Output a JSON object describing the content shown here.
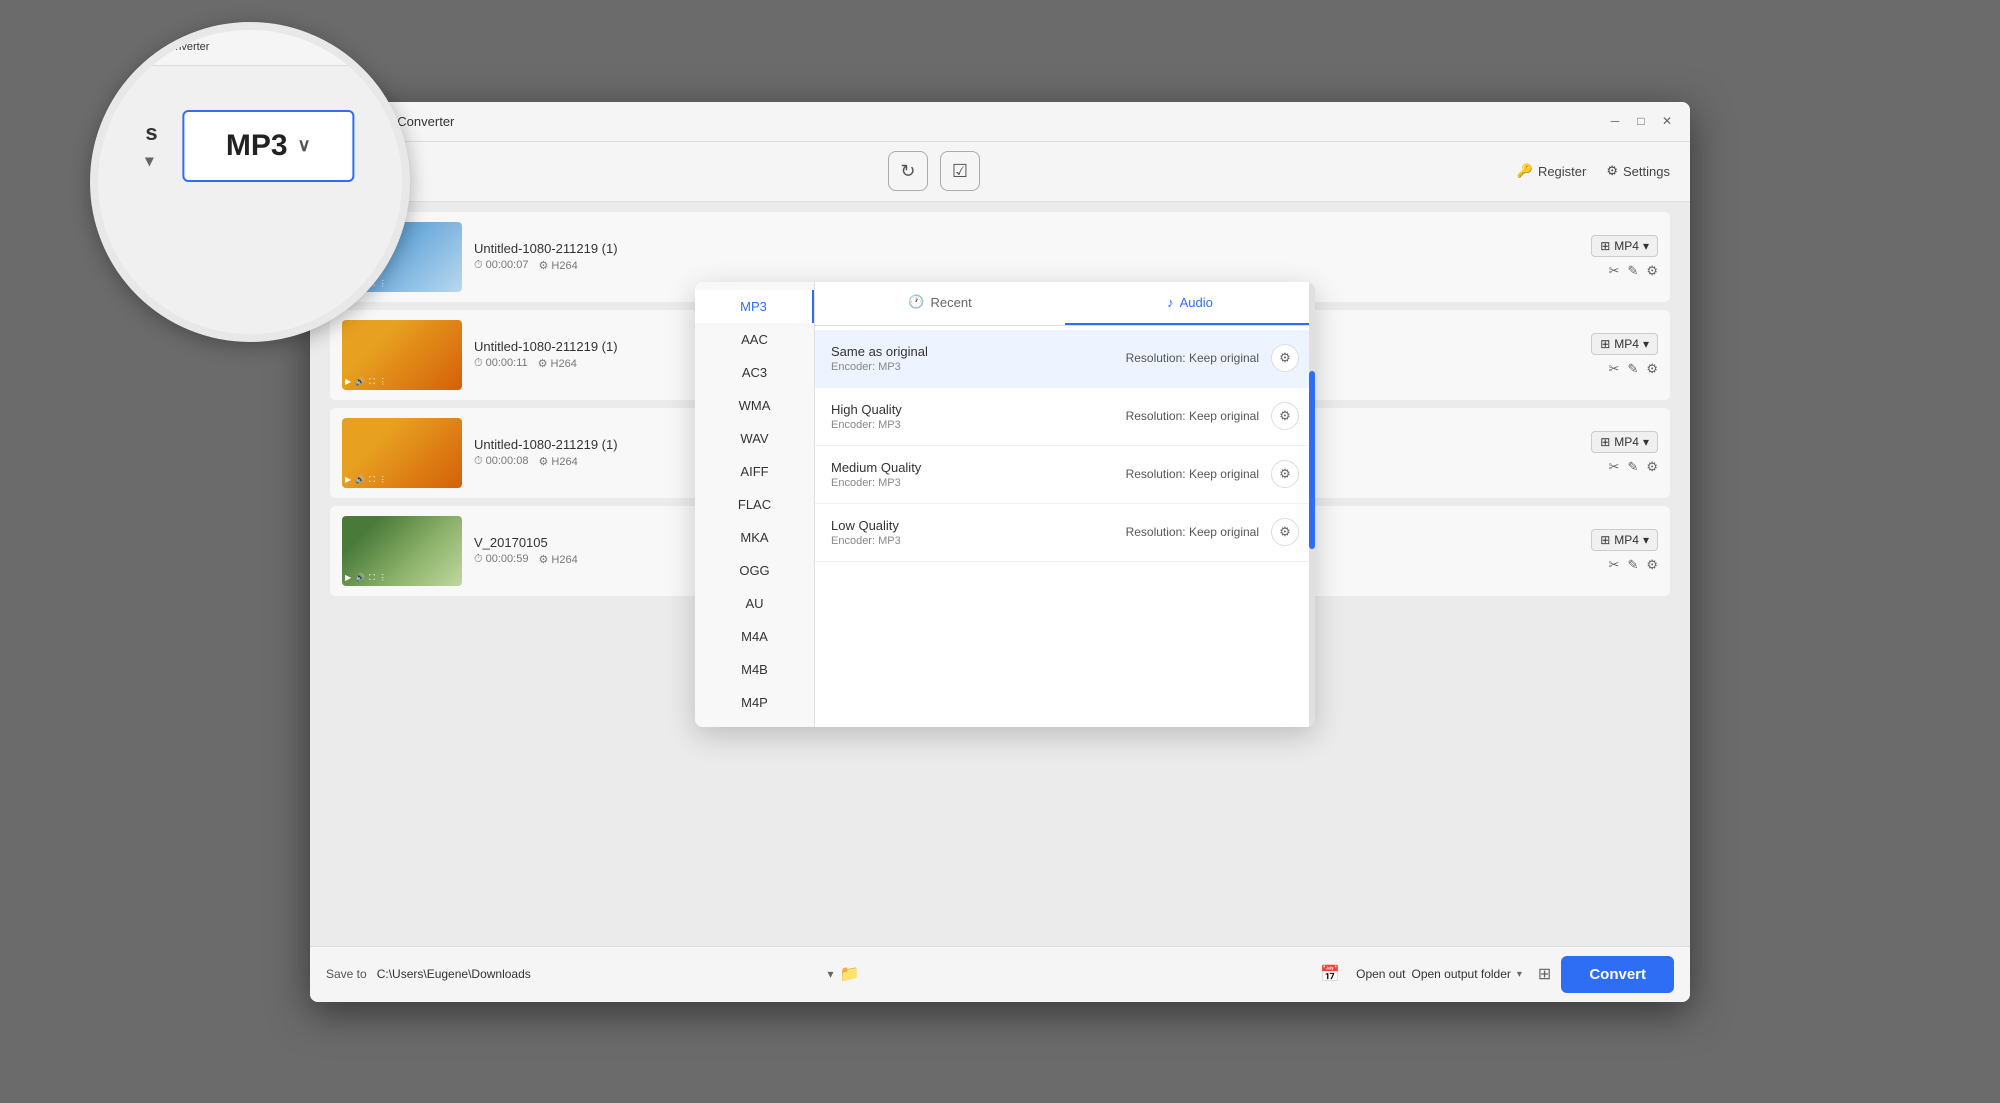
{
  "window": {
    "title": "Aisits Video Converter",
    "title_short": "nverter"
  },
  "titlebar": {
    "minimize_label": "─",
    "maximize_label": "□",
    "close_label": "✕"
  },
  "toolbar": {
    "add_files_label": "s",
    "convert_icon": "↻",
    "check_icon": "✓",
    "register_label": "Register",
    "settings_label": "Settings"
  },
  "videos": [
    {
      "name": "Untitled-1080-211219 (1)",
      "duration": "00:00:07",
      "codec": "H264",
      "format": "MP4",
      "thumb_class": "video-thumb-1"
    },
    {
      "name": "Untitled-1080-211219 (1)",
      "duration": "00:00:11",
      "codec": "H264",
      "format": "MP4",
      "thumb_class": "video-thumb-2"
    },
    {
      "name": "Untitled-1080-211219 (1)",
      "duration": "00:00:08",
      "codec": "H264",
      "format": "MP4",
      "thumb_class": "video-thumb-2"
    },
    {
      "name": "V_20170105",
      "duration": "00:00:59",
      "codec": "H264",
      "format": "MP4",
      "thumb_class": "video-thumb-3"
    }
  ],
  "bottombar": {
    "save_to_label": "Save to",
    "save_path": "C:\\Users\\Eugene\\Downloads",
    "open_output_label": "Open out",
    "open_output_folder_label": "Open output folder",
    "convert_label": "Convert"
  },
  "dropdown": {
    "tabs": [
      {
        "id": "recent",
        "label": "Recent",
        "icon": "🕐",
        "active": false
      },
      {
        "id": "audio",
        "label": "Audio",
        "icon": "♪",
        "active": true
      }
    ],
    "formats": [
      {
        "id": "mp3",
        "label": "MP3",
        "active": true
      },
      {
        "id": "aac",
        "label": "AAC",
        "active": false
      },
      {
        "id": "ac3",
        "label": "AC3",
        "active": false
      },
      {
        "id": "wma",
        "label": "WMA",
        "active": false
      },
      {
        "id": "wav",
        "label": "WAV",
        "active": false
      },
      {
        "id": "aiff",
        "label": "AIFF",
        "active": false
      },
      {
        "id": "flac",
        "label": "FLAC",
        "active": false
      },
      {
        "id": "mka",
        "label": "MKA",
        "active": false
      },
      {
        "id": "ogg",
        "label": "OGG",
        "active": false
      },
      {
        "id": "au",
        "label": "AU",
        "active": false
      },
      {
        "id": "m4a",
        "label": "M4A",
        "active": false
      },
      {
        "id": "m4b",
        "label": "M4B",
        "active": false
      },
      {
        "id": "m4p",
        "label": "M4P",
        "active": false
      }
    ],
    "quality_options": [
      {
        "name": "Same as original",
        "encoder": "Encoder: MP3",
        "resolution": "Resolution: Keep original",
        "selected": true
      },
      {
        "name": "High Quality",
        "encoder": "Encoder: MP3",
        "resolution": "Resolution: Keep original",
        "selected": false
      },
      {
        "name": "Medium Quality",
        "encoder": "Encoder: MP3",
        "resolution": "Resolution: Keep original",
        "selected": false
      },
      {
        "name": "Low Quality",
        "encoder": "Encoder: MP3",
        "resolution": "Resolution: Keep original",
        "selected": false
      }
    ]
  },
  "magnifier": {
    "title": "oits Video Converter",
    "left_label": "s",
    "mp3_label": "MP3",
    "dropdown_arrow": "∨"
  }
}
